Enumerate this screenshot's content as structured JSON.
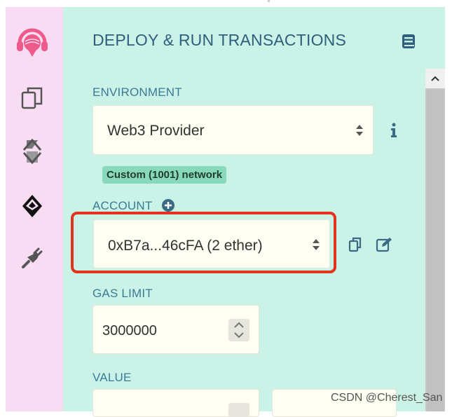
{
  "header": {
    "title": "DEPLOY & RUN TRANSACTIONS"
  },
  "environment": {
    "label": "ENVIRONMENT",
    "selected": "Web3 Provider",
    "network_badge": "Custom (1001) network"
  },
  "account": {
    "label": "ACCOUNT",
    "selected": "0xB7a...46cFA (2 ether)"
  },
  "gas_limit": {
    "label": "GAS LIMIT",
    "value": "3000000"
  },
  "value": {
    "label": "VALUE"
  },
  "watermark": "CSDN @Cherest_San",
  "sidebar": {
    "items": [
      {
        "icon": "remix-logo-icon"
      },
      {
        "icon": "file-explorer-icon"
      },
      {
        "icon": "solidity-compiler-icon"
      },
      {
        "icon": "ethereum-deploy-icon"
      },
      {
        "icon": "plugin-manager-icon"
      }
    ]
  },
  "colors": {
    "sidebar_bg": "#f7dcf3",
    "panel_bg": "#cbf2e7",
    "title": "#2f5f7d",
    "label": "#3a7a97",
    "badge_bg": "#88d8bb",
    "highlight": "#e0341c",
    "remix_logo": "#ee5a8a"
  }
}
